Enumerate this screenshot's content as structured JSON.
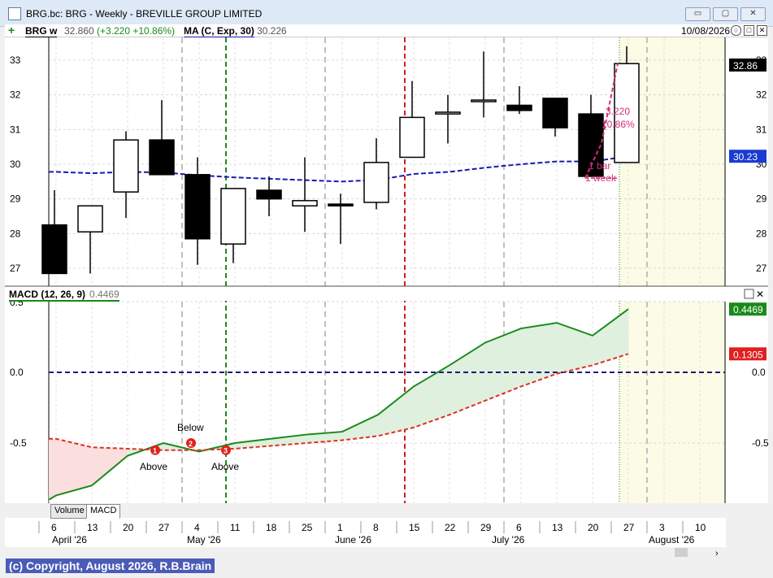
{
  "window": {
    "title": "BRG.bc: BRG - Weekly - BREVILLE GROUP LIMITED",
    "min_label": "▭",
    "max_label": "▢",
    "close_label": "✕"
  },
  "infobar": {
    "symbol": "BRG w",
    "price": "32.860",
    "change": "(+3.220 +10.86%)",
    "ma_label": "MA (C, Exp, 30)",
    "ma_value": "30.226",
    "date": "10/08/2026"
  },
  "macd_header": {
    "label": "MACD (12, 26, 9)",
    "value": "0.4469"
  },
  "tabs": [
    "Volume",
    "MACD"
  ],
  "copyright": "(c) Copyright, August 2026, R.B.Brain",
  "colors": {
    "ma_line": "#1a1ab0",
    "macd_line": "#1a8a1a",
    "signal_line": "#e03020",
    "annotation": "#d0307a",
    "future_zone": "#fbfbe6"
  },
  "chart_data": [
    {
      "type": "candlestick",
      "title": "BRG w",
      "y_ticks": [
        "33",
        "32",
        "31",
        "30",
        "29",
        "28",
        "27"
      ],
      "ylim": [
        26.6,
        33.5
      ],
      "price_label": "32.86",
      "ma_label": "30.23",
      "candles": [
        {
          "o": 28.25,
          "h": 29.25,
          "l": 26.85,
          "c": 26.85
        },
        {
          "o": 28.05,
          "h": 28.8,
          "l": 26.85,
          "c": 28.8
        },
        {
          "o": 29.2,
          "h": 30.95,
          "l": 28.45,
          "c": 30.7
        },
        {
          "o": 30.7,
          "h": 31.85,
          "l": 29.7,
          "c": 29.7
        },
        {
          "o": 29.7,
          "h": 30.2,
          "l": 27.1,
          "c": 27.85
        },
        {
          "o": 27.7,
          "h": 29.3,
          "l": 27.15,
          "c": 29.3
        },
        {
          "o": 29.25,
          "h": 29.65,
          "l": 28.5,
          "c": 29.0
        },
        {
          "o": 28.8,
          "h": 30.2,
          "l": 28.05,
          "c": 28.95
        },
        {
          "o": 28.85,
          "h": 29.15,
          "l": 27.7,
          "c": 28.8
        },
        {
          "o": 28.9,
          "h": 30.75,
          "l": 28.7,
          "c": 30.05
        },
        {
          "o": 30.2,
          "h": 32.4,
          "l": 30.2,
          "c": 31.35
        },
        {
          "o": 31.45,
          "h": 32.0,
          "l": 30.6,
          "c": 31.5
        },
        {
          "o": 31.85,
          "h": 33.25,
          "l": 31.35,
          "c": 31.85
        },
        {
          "o": 31.7,
          "h": 32.25,
          "l": 31.45,
          "c": 31.55
        },
        {
          "o": 31.9,
          "h": 31.9,
          "l": 30.8,
          "c": 31.05
        },
        {
          "o": 31.45,
          "h": 32.0,
          "l": 29.65,
          "c": 29.65
        },
        {
          "o": 30.05,
          "h": 33.4,
          "l": 30.05,
          "c": 32.9
        }
      ],
      "ma_values": [
        29.78,
        29.74,
        29.78,
        29.76,
        29.68,
        29.62,
        29.58,
        29.54,
        29.5,
        29.55,
        29.72,
        29.78,
        29.9,
        30.0,
        30.08,
        30.08,
        30.23
      ],
      "annotation": {
        "change": "3.220",
        "percent": "10.86%",
        "bars": "1 bar",
        "period": "1 week"
      }
    },
    {
      "type": "line",
      "title": "MACD (12, 26, 9)",
      "y_ticks": [
        "0.0",
        "-0.5"
      ],
      "ylim": [
        -0.92,
        0.52
      ],
      "series": [
        {
          "name": "MACD",
          "values": [
            -0.87,
            -0.8,
            -0.59,
            -0.5,
            -0.56,
            -0.5,
            -0.47,
            -0.44,
            -0.42,
            -0.3,
            -0.1,
            0.05,
            0.21,
            0.31,
            0.35,
            0.26,
            0.4469
          ]
        },
        {
          "name": "Signal",
          "values": [
            -0.47,
            -0.53,
            -0.54,
            -0.55,
            -0.55,
            -0.54,
            -0.52,
            -0.5,
            -0.48,
            -0.45,
            -0.39,
            -0.3,
            -0.2,
            -0.1,
            -0.01,
            0.05,
            0.1305
          ]
        }
      ],
      "value_labels": [
        "0.4469",
        "0.1305"
      ],
      "markers": [
        {
          "num": "1",
          "text": "Above"
        },
        {
          "num": "2",
          "text": "Below"
        },
        {
          "num": "3",
          "text": "Above"
        }
      ]
    }
  ],
  "x_axis": {
    "day_ticks": [
      "6",
      "13",
      "20",
      "27",
      "4",
      "11",
      "18",
      "25",
      "1",
      "8",
      "15",
      "22",
      "29",
      "6",
      "13",
      "20",
      "27",
      "3",
      "10"
    ],
    "months": [
      "April '26",
      "May '26",
      "June '26",
      "July '26",
      "August '26"
    ]
  }
}
